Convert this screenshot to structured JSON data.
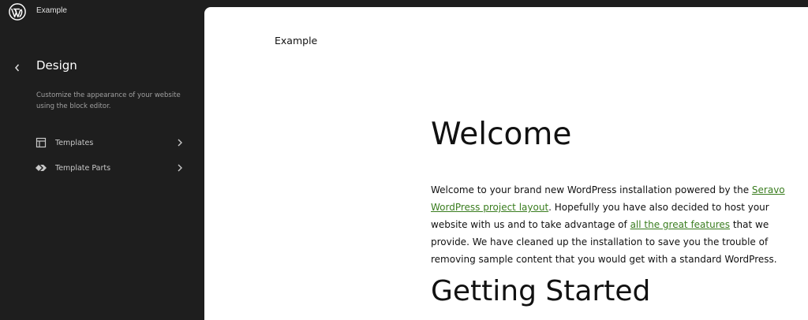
{
  "header": {
    "site_title": "Example"
  },
  "sidebar": {
    "title": "Design",
    "description": "Customize the appearance of your website using the block editor.",
    "items": [
      {
        "label": "Templates",
        "icon": "layout-icon"
      },
      {
        "label": "Template Parts",
        "icon": "symbol-filled-icon"
      }
    ]
  },
  "canvas": {
    "site_title": "Example",
    "heading": "Welcome",
    "paragraph": {
      "part1": "Welcome to your brand new WordPress installation powered by the ",
      "link1": "Seravo WordPress project layout",
      "part2": ". Hopefully you have also decided to host your website with us and to take advantage of ",
      "link2": "all the great features",
      "part3": " that we provide. We have cleaned up the installation to save you the trouble of removing sample content that you would get with a standard WordPress."
    },
    "heading2": "Getting Started"
  },
  "colors": {
    "sidebar_bg": "#1e1e1e",
    "canvas_bg": "#ffffff",
    "link": "#3a7d1f"
  }
}
